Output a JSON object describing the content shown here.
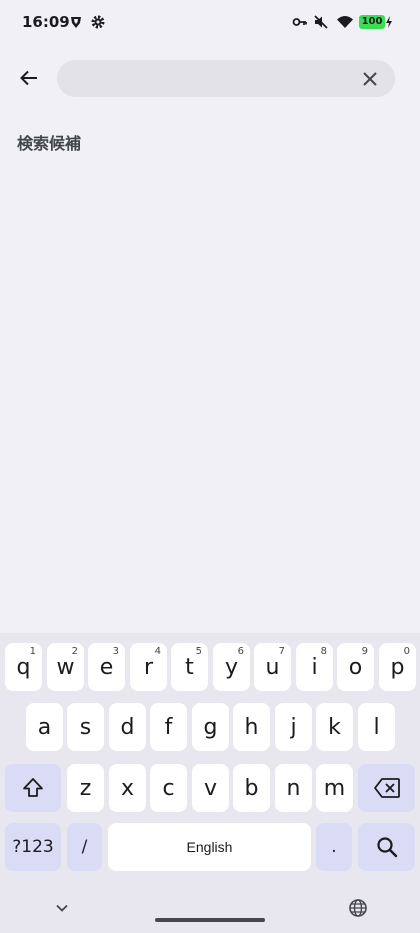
{
  "status_bar": {
    "time": "16:09",
    "battery": "100",
    "icons": [
      "brave-icon",
      "settings-icon",
      "vpn-key-icon",
      "mute-icon",
      "wifi-icon",
      "battery-icon",
      "charging-icon"
    ]
  },
  "search": {
    "value": "",
    "placeholder": ""
  },
  "section": {
    "title": "検索候補"
  },
  "keyboard": {
    "row1": [
      {
        "key": "q",
        "hint": "1"
      },
      {
        "key": "w",
        "hint": "2"
      },
      {
        "key": "e",
        "hint": "3"
      },
      {
        "key": "r",
        "hint": "4"
      },
      {
        "key": "t",
        "hint": "5"
      },
      {
        "key": "y",
        "hint": "6"
      },
      {
        "key": "u",
        "hint": "7"
      },
      {
        "key": "i",
        "hint": "8"
      },
      {
        "key": "o",
        "hint": "9"
      },
      {
        "key": "p",
        "hint": "0"
      }
    ],
    "row2": [
      "a",
      "s",
      "d",
      "f",
      "g",
      "h",
      "j",
      "k",
      "l"
    ],
    "row3": [
      "z",
      "x",
      "c",
      "v",
      "b",
      "n",
      "m"
    ],
    "symbols_label": "?123",
    "slash_label": "/",
    "space_label": "English",
    "period_label": ".",
    "colors": {
      "key_bg": "#ffffff",
      "func_key_bg": "#d9dcf4",
      "keyboard_bg": "#e8e7f0"
    }
  }
}
